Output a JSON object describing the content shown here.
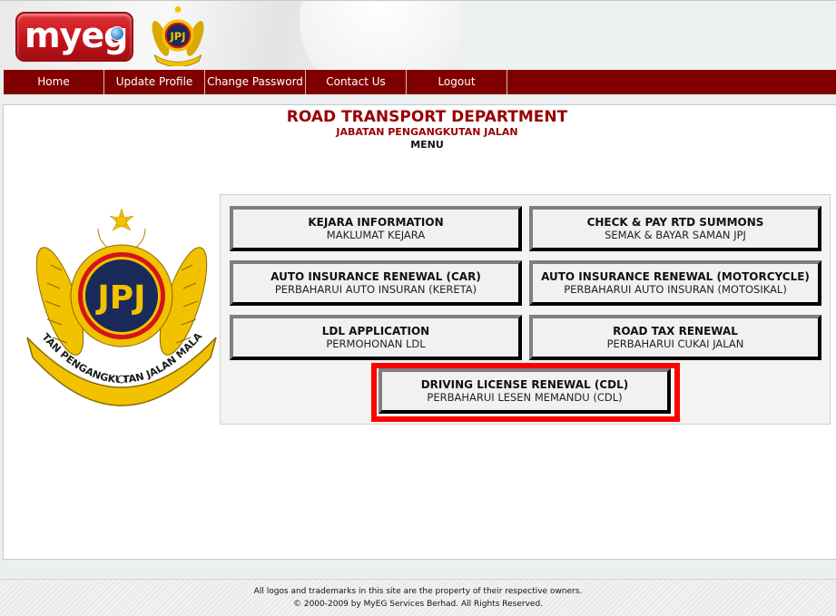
{
  "header": {
    "logo_text": "myeg",
    "logo_icon": "globe-icon",
    "agency_emblem": "jpj-emblem-icon"
  },
  "nav": {
    "items": [
      {
        "label": "Home"
      },
      {
        "label": "Update Profile"
      },
      {
        "label": "Change Password"
      },
      {
        "label": "Contact Us"
      },
      {
        "label": "Logout"
      }
    ]
  },
  "main": {
    "title": "ROAD TRANSPORT DEPARTMENT",
    "subtitle": "JABATAN PENGANGKUTAN JALAN",
    "section": "MENU",
    "emblem_text": "JABATAN PENGANGKUTAN JALAN MALAYSIA",
    "emblem_letters": "JPJ",
    "menu": [
      {
        "en": "KEJARA INFORMATION",
        "ms": "MAKLUMAT KEJARA"
      },
      {
        "en": "CHECK & PAY RTD SUMMONS",
        "ms": "SEMAK & BAYAR SAMAN JPJ"
      },
      {
        "en": "AUTO INSURANCE RENEWAL (CAR)",
        "ms": "PERBAHARUI AUTO INSURAN (KERETA)"
      },
      {
        "en": "AUTO INSURANCE RENEWAL (MOTORCYCLE)",
        "ms": "PERBAHARUI AUTO INSURAN (MOTOSIKAL)"
      },
      {
        "en": "LDL APPLICATION",
        "ms": "PERMOHONAN LDL"
      },
      {
        "en": "ROAD TAX RENEWAL",
        "ms": "PERBAHARUI CUKAI JALAN"
      },
      {
        "en": "DRIVING LICENSE RENEWAL (CDL)",
        "ms": "PERBAHARUI LESEN MEMANDU (CDL)",
        "highlighted": true
      }
    ],
    "highlight_color": "#ff0000"
  },
  "colors": {
    "nav_bg": "#800000",
    "title": "#990000"
  },
  "footer": {
    "line1": "All logos and trademarks in this site are the property of their respective owners.",
    "line2": "© 2000-2009 by MyEG Services Berhad. All Rights Reserved."
  }
}
